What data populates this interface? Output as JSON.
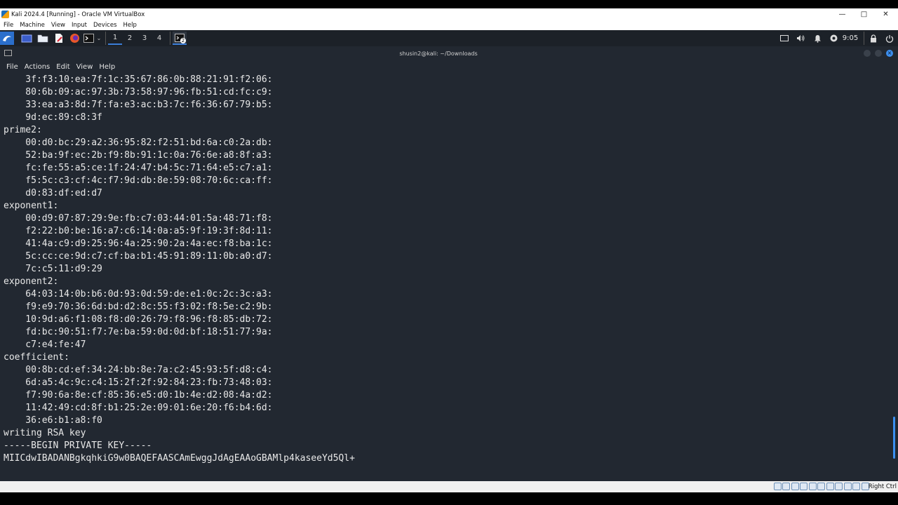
{
  "vbox": {
    "title": "Kali 2024.4 [Running] - Oracle VM VirtualBox",
    "menu": [
      "File",
      "Machine",
      "View",
      "Input",
      "Devices",
      "Help"
    ],
    "status_hostkey": "Right Ctrl"
  },
  "panel": {
    "workspaces": [
      "1",
      "2",
      "3",
      "4"
    ],
    "clock": "9:05",
    "terminal_badge": "2"
  },
  "terminal": {
    "title": "shusin2@kali: ~/Downloads",
    "menu": [
      "File",
      "Actions",
      "Edit",
      "View",
      "Help"
    ],
    "lines": [
      "    3f:f3:10:ea:7f:1c:35:67:86:0b:88:21:91:f2:06:",
      "    80:6b:09:ac:97:3b:73:58:97:96:fb:51:cd:fc:c9:",
      "    33:ea:a3:8d:7f:fa:e3:ac:b3:7c:f6:36:67:79:b5:",
      "    9d:ec:89:c8:3f",
      "prime2:",
      "    00:d0:bc:29:a2:36:95:82:f2:51:bd:6a:c0:2a:db:",
      "    52:ba:9f:ec:2b:f9:8b:91:1c:0a:76:6e:a8:8f:a3:",
      "    fc:fe:55:a5:ce:1f:24:47:b4:5c:71:64:e5:c7:a1:",
      "    f5:5c:c3:cf:4c:f7:9d:db:8e:59:08:70:6c:ca:ff:",
      "    d0:83:df:ed:d7",
      "exponent1:",
      "    00:d9:07:87:29:9e:fb:c7:03:44:01:5a:48:71:f8:",
      "    f2:22:b0:be:16:a7:c6:14:0a:a5:9f:19:3f:8d:11:",
      "    41:4a:c9:d9:25:96:4a:25:90:2a:4a:ec:f8:ba:1c:",
      "    5c:cc:ce:9d:c7:cf:ba:b1:45:91:89:11:0b:a0:d7:",
      "    7c:c5:11:d9:29",
      "exponent2:",
      "    64:03:14:0b:b6:0d:93:0d:59:de:e1:0c:2c:3c:a3:",
      "    f9:e9:70:36:6d:bd:d2:8c:55:f3:02:f8:5e:c2:9b:",
      "    10:9d:a6:f1:08:f8:d0:26:79:f8:96:f8:85:db:72:",
      "    fd:bc:90:51:f7:7e:ba:59:0d:0d:bf:18:51:77:9a:",
      "    c7:e4:fe:47",
      "coefficient:",
      "    00:8b:cd:ef:34:24:bb:8e:7a:c2:45:93:5f:d8:c4:",
      "    6d:a5:4c:9c:c4:15:2f:2f:92:84:23:fb:73:48:03:",
      "    f7:90:6a:8e:cf:85:36:e5:d0:1b:4e:d2:08:4a:d2:",
      "    11:42:49:cd:8f:b1:25:2e:09:01:6e:20:f6:b4:6d:",
      "    36:e6:b1:a8:f0",
      "writing RSA key",
      "-----BEGIN PRIVATE KEY-----",
      "MIICdwIBADANBgkqhkiG9w0BAQEFAASCAmEwggJdAgEAAoGBAMlp4kaseeYd5Ql+"
    ]
  }
}
